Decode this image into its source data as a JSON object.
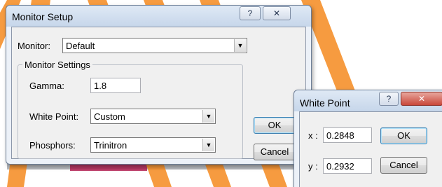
{
  "monitor_setup": {
    "title": "Monitor Setup",
    "help_button": "?",
    "close_button": "✕",
    "monitor_label": "Monitor:",
    "monitor_value": "Default",
    "group_title": "Monitor Settings",
    "gamma_label": "Gamma:",
    "gamma_value": "1.8",
    "white_point_label": "White Point:",
    "white_point_value": "Custom",
    "phosphors_label": "Phosphors:",
    "phosphors_value": "Trinitron",
    "ok_label": "OK",
    "cancel_label": "Cancel"
  },
  "white_point": {
    "title": "White Point",
    "help_button": "?",
    "close_button": "✕",
    "x_label": "x :",
    "x_value": "0.2848",
    "y_label": "y :",
    "y_value": "0.2932",
    "ok_label": "OK",
    "cancel_label": "Cancel"
  },
  "icons": {
    "dropdown_arrow": "chevron-down-icon",
    "help": "help-icon",
    "close": "close-icon"
  },
  "colors": {
    "accent_stripes": "#f58a1f",
    "close_button_red": "#c9473a",
    "window_frame": "#c6d6ea"
  }
}
